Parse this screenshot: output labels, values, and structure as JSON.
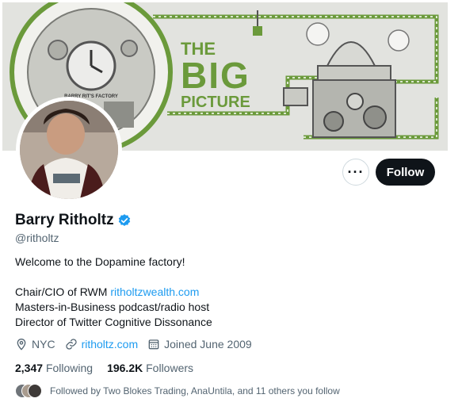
{
  "banner": {
    "title_line1": "THE",
    "title_line2": "BIG",
    "title_line3": "PICTURE",
    "clock_caption": "BARRY RIT'S FACTORY"
  },
  "profile": {
    "display_name": "Barry Ritholtz",
    "handle": "@ritholtz",
    "bio": {
      "line1": "Welcome to the Dopamine factory!",
      "line2_prefix": "Chair/CIO of RWM ",
      "line2_link": "ritholtzwealth.com",
      "line3": "Masters-in-Business podcast/radio host",
      "line4": "Director of Twitter Cognitive Dissonance"
    },
    "location": "NYC",
    "website": "ritholtz.com",
    "joined": "Joined June 2009"
  },
  "actions": {
    "more_label": "···",
    "follow_label": "Follow"
  },
  "stats": {
    "following_count": "2,347",
    "following_label": "Following",
    "followers_count": "196.2K",
    "followers_label": "Followers"
  },
  "followed_by": "Followed by Two Blokes Trading, AnaUntila, and 11 others you follow",
  "colors": {
    "accent": "#1d9bf0",
    "banner_green": "#6b9a3b",
    "text_primary": "#0f1419",
    "text_secondary": "#536471"
  }
}
